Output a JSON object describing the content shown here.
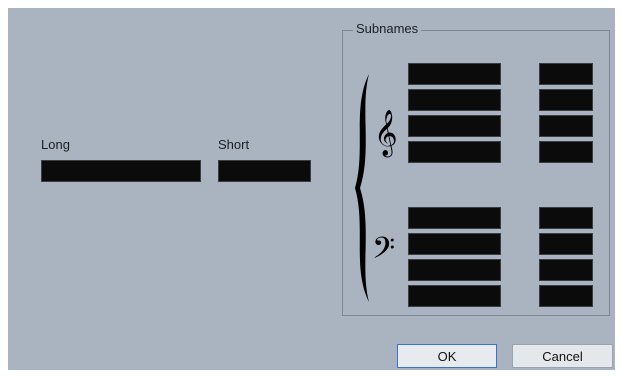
{
  "fields": {
    "long_label": "Long",
    "short_label": "Short"
  },
  "subnames": {
    "title": "Subnames",
    "treble_clef_icon": "treble-clef",
    "bass_clef_icon": "bass-clef"
  },
  "buttons": {
    "ok": "OK",
    "cancel": "Cancel"
  }
}
